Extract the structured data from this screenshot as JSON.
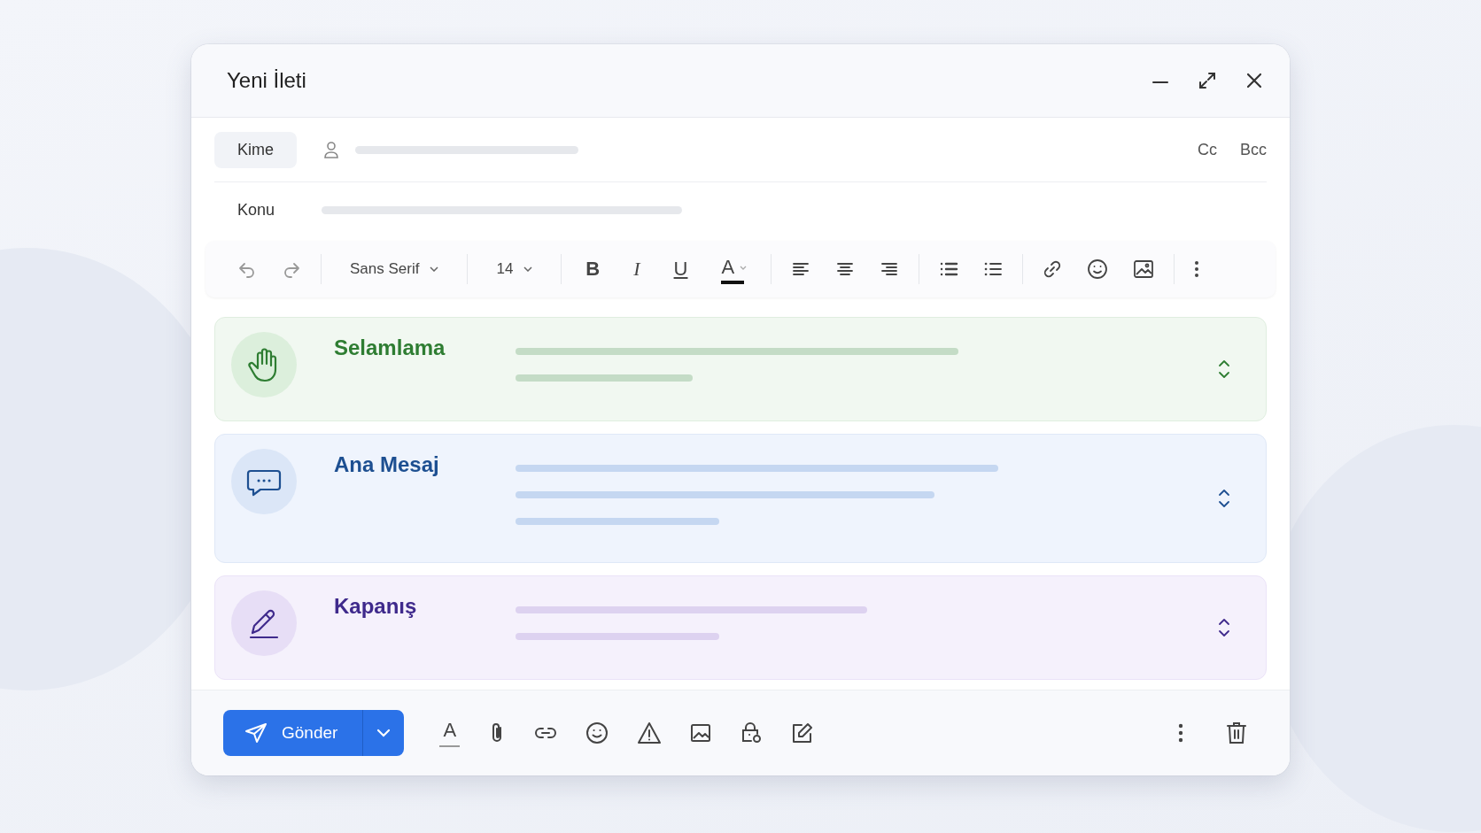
{
  "window": {
    "title": "Yeni İleti"
  },
  "to": {
    "label": "Kime",
    "cc": "Cc",
    "bcc": "Bcc"
  },
  "subject": {
    "label": "Konu"
  },
  "toolbar": {
    "font": "Sans Serif",
    "size": "14",
    "bold": "B",
    "italic": "I",
    "underline": "U",
    "text_color": "A"
  },
  "sections": [
    {
      "kind": "greeting",
      "title": "Selamlama",
      "color": "#2e7d32"
    },
    {
      "kind": "body",
      "title": "Ana Mesaj",
      "color": "#1d4f91"
    },
    {
      "kind": "closing",
      "title": "Kapanış",
      "color": "#3f2a8c"
    }
  ],
  "footer": {
    "send": "Gönder",
    "format": "A"
  }
}
